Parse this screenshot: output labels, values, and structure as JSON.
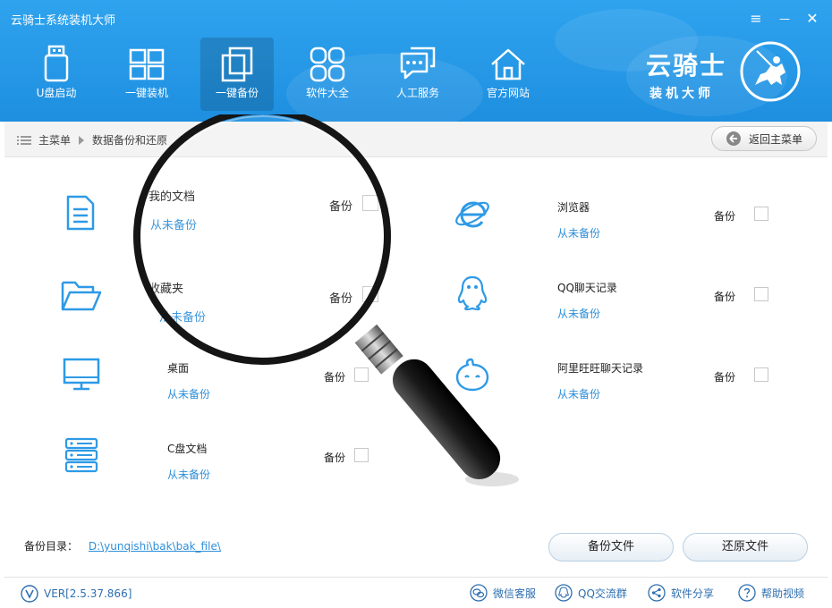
{
  "app": {
    "title": "云骑士系统装机大师"
  },
  "window_controls": {
    "menu": "≡",
    "minimize": "—",
    "close": "✕"
  },
  "nav": [
    {
      "label": "U盘启动",
      "icon": "usb-icon"
    },
    {
      "label": "一键装机",
      "icon": "windows-icon"
    },
    {
      "label": "一键备份",
      "icon": "backup-icon",
      "active": true
    },
    {
      "label": "软件大全",
      "icon": "apps-icon"
    },
    {
      "label": "人工服务",
      "icon": "chat-icon"
    },
    {
      "label": "官方网站",
      "icon": "home-icon"
    }
  ],
  "brand": {
    "line1": "云骑士",
    "line2": "装机大师"
  },
  "breadcrumb": {
    "root": "主菜单",
    "current": "数据备份和还原",
    "back_button": "返回主菜单"
  },
  "items": [
    {
      "name": "我的文档",
      "status": "从未备份",
      "backup_label": "备份",
      "icon": "document-icon"
    },
    {
      "name": "收藏夹",
      "status": "从未备份",
      "backup_label": "备份",
      "icon": "folder-icon"
    },
    {
      "name": "桌面",
      "status": "从未备份",
      "backup_label": "备份",
      "icon": "monitor-icon"
    },
    {
      "name": "C盘文档",
      "status": "从未备份",
      "backup_label": "备份",
      "icon": "server-icon"
    },
    {
      "name": "浏览器",
      "status": "从未备份",
      "backup_label": "备份",
      "icon": "ie-icon"
    },
    {
      "name": "QQ聊天记录",
      "status": "从未备份",
      "backup_label": "备份",
      "icon": "qq-icon"
    },
    {
      "name": "阿里旺旺聊天记录",
      "status": "从未备份",
      "backup_label": "备份",
      "icon": "wangwang-icon"
    }
  ],
  "backup_dir": {
    "label": "备份目录：",
    "path": "D:\\yunqishi\\bak\\bak_file\\"
  },
  "buttons": {
    "backup": "备份文件",
    "restore": "还原文件"
  },
  "footer": {
    "version": "VER[2.5.37.866]",
    "links": [
      "微信客服",
      "QQ交流群",
      "软件分享",
      "帮助视频"
    ]
  },
  "colors": {
    "header": "#1e8fe0",
    "accent": "#2e8fd8"
  }
}
